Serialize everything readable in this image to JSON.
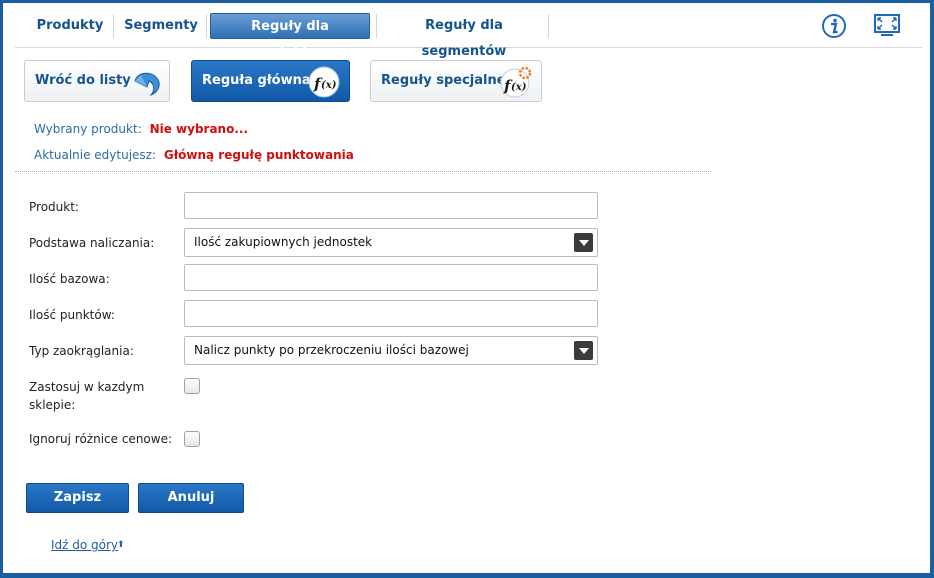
{
  "tabs": [
    {
      "label": "Produkty"
    },
    {
      "label": "Segmenty"
    },
    {
      "label": "Reguły dla produktów",
      "active": true
    },
    {
      "label": "Reguły dla segmentów"
    }
  ],
  "top_icons": [
    "info-icon",
    "fullscreen-icon"
  ],
  "buttons": {
    "back": "Wróć do listy",
    "main_rule": "Reguła główna",
    "special_rules": "Reguły specjalne"
  },
  "info": {
    "selected_product_label": "Wybrany produkt:",
    "selected_product_value": "Nie wybrano...",
    "editing_label": "Aktualnie edytujesz:",
    "editing_value": "Główną regułę punktowania"
  },
  "form": {
    "product_label": "Produkt:",
    "product_value": "",
    "basis_label": "Podstawa naliczania:",
    "basis_value": "Ilość zakupiownych jednostek",
    "base_qty_label": "Ilość bazowa:",
    "base_qty_value": "",
    "points_label": "Ilość punktów:",
    "points_value": "",
    "rounding_label": "Typ zaokrąglania:",
    "rounding_value": "Nalicz punkty po przekroczeniu ilości bazowej",
    "every_store_label": "Zastosuj w kazdym sklepie:",
    "every_store_checked": false,
    "ignore_price_label": "Ignoruj różnice cenowe:",
    "ignore_price_checked": false
  },
  "actions": {
    "save": "Zapisz",
    "cancel": "Anuluj"
  },
  "footer": {
    "top_link": "Idź do góry",
    "top_link_icon": "double-chevron-up-icon"
  },
  "colors": {
    "frame": "#1a5fa0",
    "primary": "#1763b1",
    "link": "#14548f",
    "alert": "#d10f0f"
  }
}
